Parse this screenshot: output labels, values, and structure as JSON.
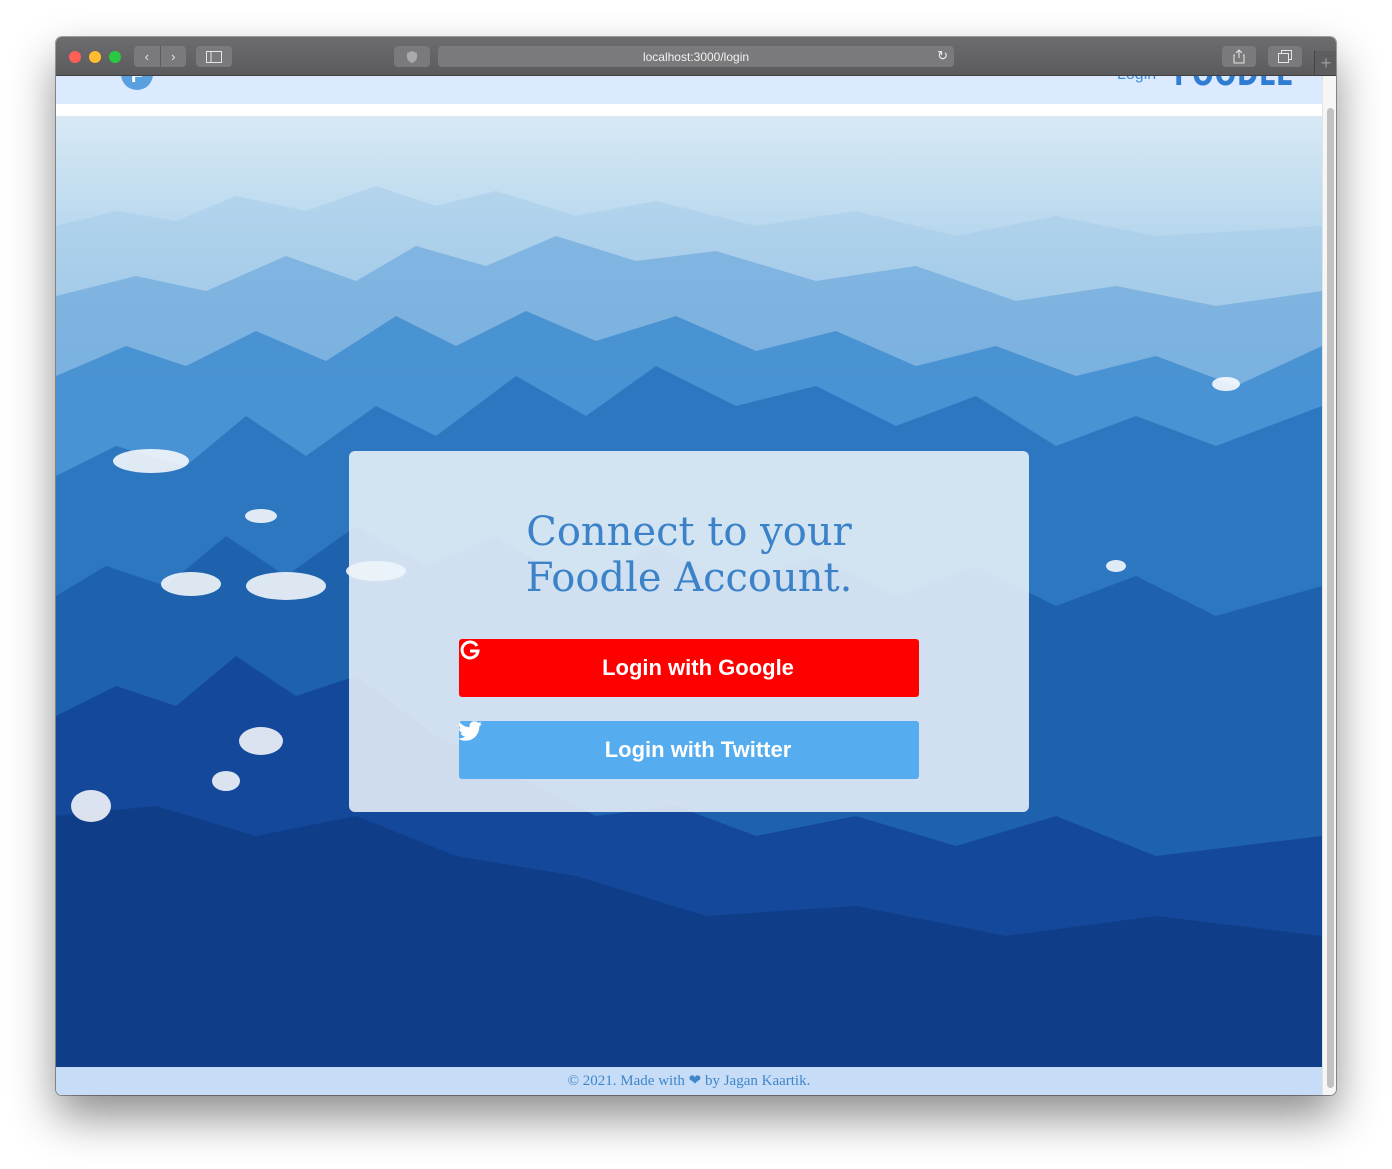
{
  "browser": {
    "url": "localhost:3000/login",
    "icons": [
      "back-icon",
      "forward-icon",
      "sidebar-icon",
      "shield-icon",
      "reload-icon",
      "share-icon",
      "tabs-icon",
      "plus-icon"
    ]
  },
  "navbar": {
    "logo_letter": "F",
    "login_link": "Login",
    "brand": "FOODLE"
  },
  "card": {
    "title_line1": "Connect to your",
    "title_line2": "Foodle Account.",
    "google_button": "Login with Google",
    "twitter_button": "Login with Twitter"
  },
  "footer": {
    "text_before": "© 2021. Made with ",
    "heart": "❤",
    "text_after": " by Jagan Kaartik."
  },
  "colors": {
    "google": "#ff0000",
    "twitter": "#55acee",
    "accent": "#3b82c9",
    "navbar_bg": "#dbeafe",
    "footer_bg": "#c6dcf7"
  }
}
